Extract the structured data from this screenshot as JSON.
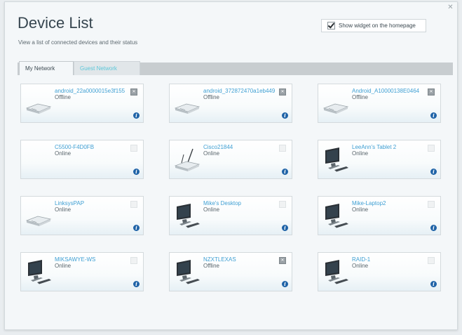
{
  "header": {
    "title": "Device List",
    "subtitle": "View a list of connected devices and their status",
    "widget_label": "Show widget on the homepage",
    "widget_checked": true
  },
  "tabs": [
    {
      "label": "My Network",
      "active": true
    },
    {
      "label": "Guest Network",
      "active": false
    }
  ],
  "devices": [
    {
      "name": "android_22a0000015e3f155",
      "status": "Offline",
      "icon": "router-icon",
      "removable": true
    },
    {
      "name": "android_372872470a1eb449",
      "status": "Offline",
      "icon": "router-icon",
      "removable": true
    },
    {
      "name": "Android_A10000138E0464",
      "status": "Offline",
      "icon": "router-icon",
      "removable": true
    },
    {
      "name": "C5500-F4D0FB",
      "status": "Online",
      "icon": "",
      "removable": false
    },
    {
      "name": "Cisco21844",
      "status": "Online",
      "icon": "wireless-router-icon",
      "removable": false
    },
    {
      "name": "LeeAnn's Tablet 2",
      "status": "Online",
      "icon": "desktop-computer-icon",
      "removable": false
    },
    {
      "name": "LinksysPAP",
      "status": "Online",
      "icon": "router-icon",
      "removable": false
    },
    {
      "name": "Mike's Desktop",
      "status": "Online",
      "icon": "desktop-computer-icon",
      "removable": false
    },
    {
      "name": "Mike-Laptop2",
      "status": "Online",
      "icon": "desktop-computer-icon",
      "removable": false
    },
    {
      "name": "MIKSAWYE-WS",
      "status": "Online",
      "icon": "desktop-computer-icon",
      "removable": false
    },
    {
      "name": "NZXTLEXAS",
      "status": "Offline",
      "icon": "desktop-computer-icon",
      "removable": true
    },
    {
      "name": "RAID-1",
      "status": "Online",
      "icon": "desktop-computer-icon",
      "removable": false
    }
  ],
  "colors": {
    "accent_link": "#3f9fd3",
    "info_badge": "#1f63a7",
    "guest_tab": "#5dc7d9"
  }
}
